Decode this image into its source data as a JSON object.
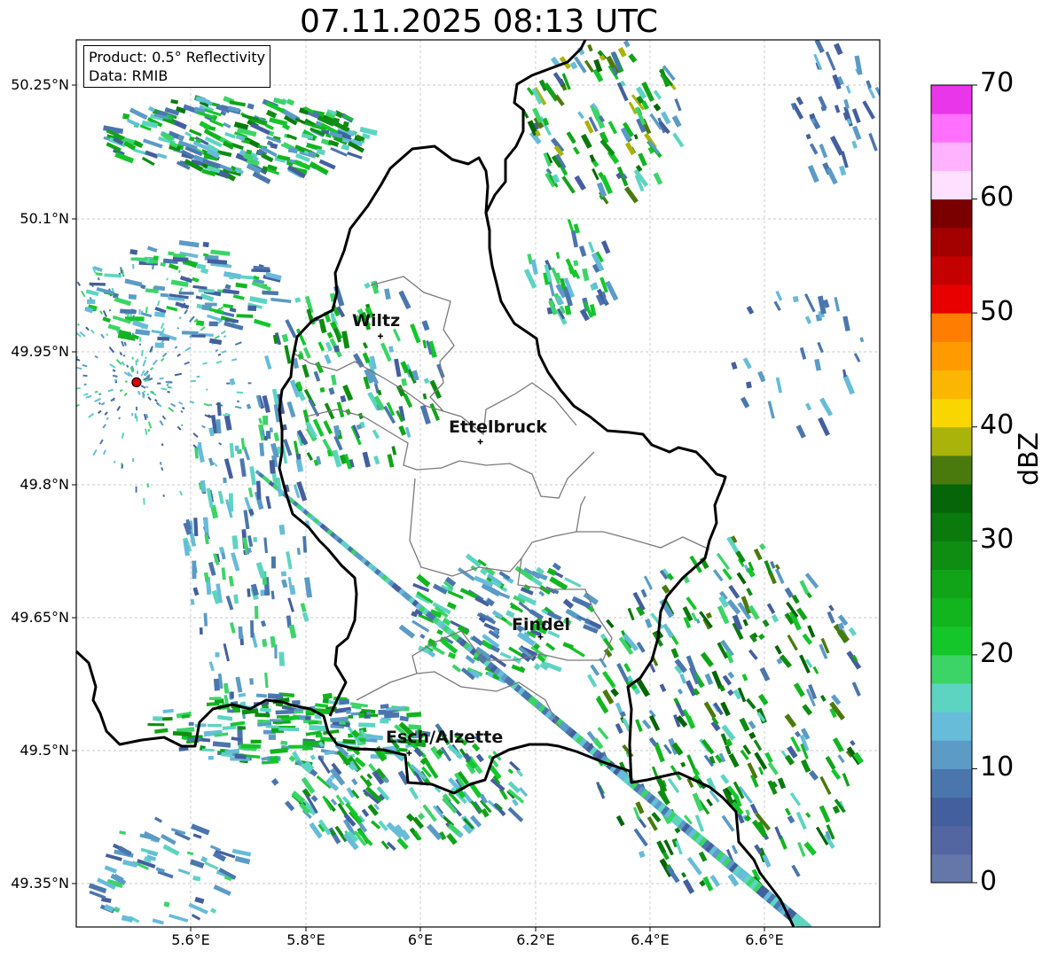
{
  "title": "07.11.2025 08:13 UTC",
  "info": {
    "product": "Product: 0.5° Reflectivity",
    "data": "Data: RMIB"
  },
  "cities": [
    {
      "name": "Wiltz",
      "lon": 5.93,
      "lat": 49.966
    },
    {
      "name": "Ettelbruck",
      "lon": 6.104,
      "lat": 49.847
    },
    {
      "name": "Findel",
      "lon": 6.209,
      "lat": 49.627
    },
    {
      "name": "Esch/Alzette",
      "lon": 5.98,
      "lat": 49.496
    }
  ],
  "radar_site": {
    "lon": 5.505,
    "lat": 49.914
  },
  "lat_labels": [
    "50.25°N",
    "50.1°N",
    "49.95°N",
    "49.8°N",
    "49.65°N",
    "49.5°N",
    "49.35°N"
  ],
  "lon_labels": [
    "5.6°E",
    "5.8°E",
    "6°E",
    "6.2°E",
    "6.4°E",
    "6.6°E"
  ],
  "extent": {
    "lon_min": 5.4,
    "lon_max": 6.8,
    "lat_min": 49.3,
    "lat_max": 50.3
  },
  "colorbar": {
    "label": "dBZ",
    "ticks": [
      "0",
      "10",
      "20",
      "30",
      "40",
      "50",
      "60",
      "70"
    ],
    "min": 0,
    "max": 70,
    "step": 2.5,
    "colors": [
      "#6577a8",
      "#5466a2",
      "#445f9e",
      "#4a76ad",
      "#5b9bc6",
      "#66bcd9",
      "#5dd4c1",
      "#3cd467",
      "#14c62a",
      "#13b51f",
      "#11a418",
      "#0e8d12",
      "#0a7a0d",
      "#076509",
      "#4a7a0d",
      "#aab30a",
      "#f9d600",
      "#fbb604",
      "#ff9a00",
      "#ff7d00",
      "#e80000",
      "#c40000",
      "#a30000",
      "#7a0000",
      "#ffe1ff",
      "#ffb3ff",
      "#ff70ff",
      "#ea36ea"
    ]
  }
}
